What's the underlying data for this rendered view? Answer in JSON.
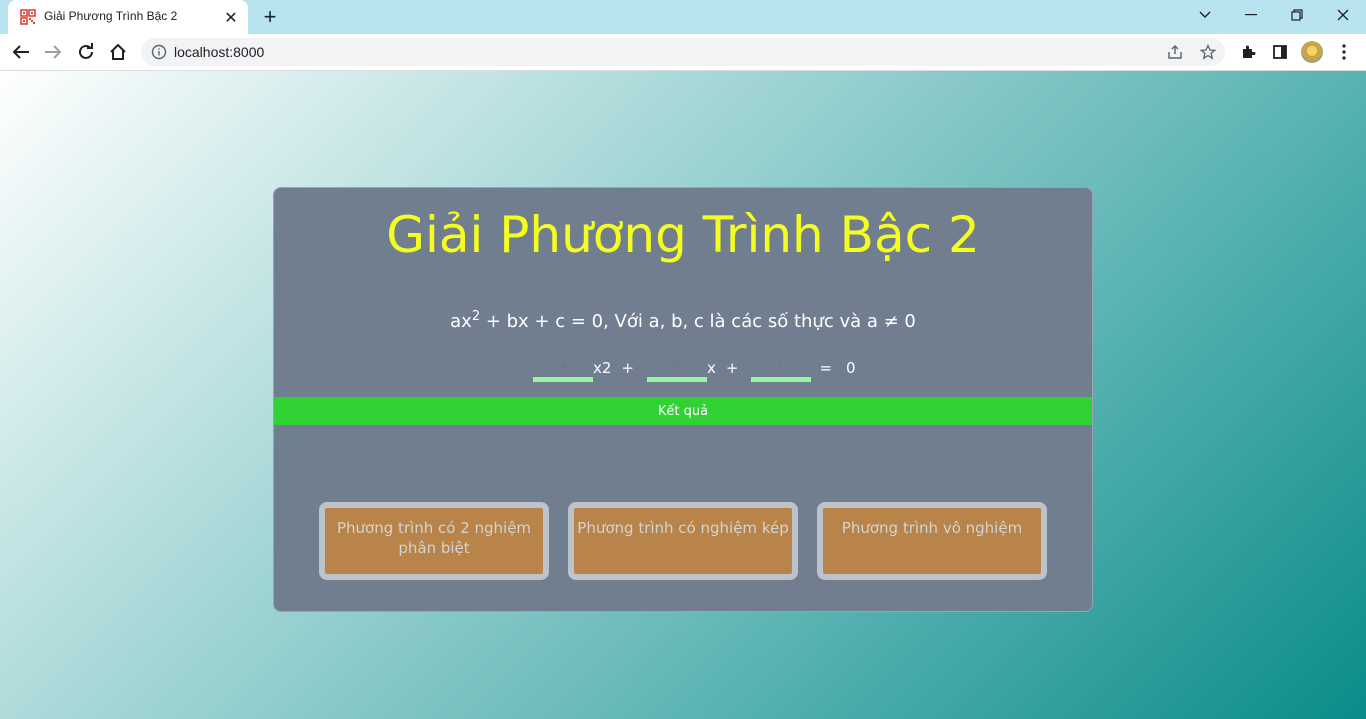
{
  "browser": {
    "tab_title": "Giải Phương Trình Bậc 2",
    "tab_close": "✕",
    "new_tab": "+",
    "url": "localhost:8000",
    "window_controls": {
      "dropdown": "⌄",
      "minimize": "—",
      "restore": "❐",
      "close": "✕"
    },
    "icons": [
      "back-icon",
      "forward-icon",
      "reload-icon",
      "home-icon",
      "info-icon",
      "share-icon",
      "bookmark-star-icon",
      "extensions-icon",
      "side-panel-icon",
      "profile-avatar",
      "menu-kebab-icon"
    ]
  },
  "app": {
    "title": "Giải Phương Trình Bậc 2",
    "equation": {
      "prefix": "ax",
      "exponent": "2",
      "suffix": " + bx + c = 0, Với a, b, c là các số thực và a ≠ 0"
    },
    "inputs": {
      "a_placeholder": "a",
      "x2_label": "x2",
      "plus1": "+",
      "b_placeholder": "b",
      "x_label": "x",
      "plus2": "+",
      "c_placeholder": "c",
      "equals": "=",
      "zero": "0"
    },
    "result_button": "Kết quả",
    "cases": [
      "Phương trình có 2 nghiệm phân biệt",
      "Phương trình có nghiệm kép",
      "Phương trình vô nghiệm"
    ],
    "colors": {
      "title": "#f5ff1f",
      "card_bg": "#717e8f",
      "result_bg": "#2fd232",
      "case_bg": "#b8844a",
      "input_underline": "#98f5a0"
    }
  }
}
